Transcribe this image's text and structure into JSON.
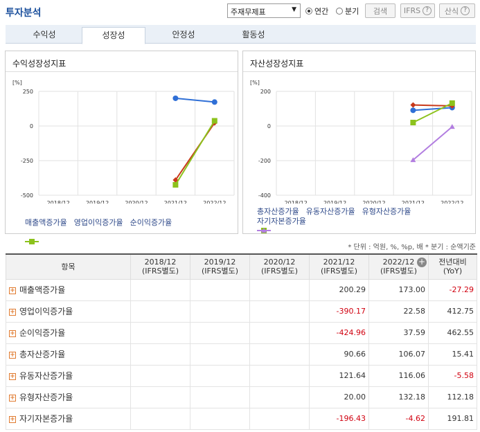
{
  "header": {
    "title": "투자분석",
    "select_value": "주재무제표",
    "radio_annual": "연간",
    "radio_quarter": "분기",
    "search_label": "검색",
    "ifrs_label": "IFRS",
    "formula_label": "산식"
  },
  "tabs": [
    "수익성",
    "성장성",
    "안정성",
    "활동성"
  ],
  "active_tab": 1,
  "panels": {
    "left_title": "수익성장성지표",
    "right_title": "자산성장성지표",
    "unit_label": "[%]"
  },
  "chart_data": [
    {
      "type": "line",
      "title": "수익성장성지표",
      "ylabel": "[%]",
      "categories": [
        "2018/12",
        "2019/12",
        "2020/12",
        "2021/12",
        "2022/12"
      ],
      "ylim": [
        -500,
        250
      ],
      "yticks": [
        250,
        0,
        -250,
        -500
      ],
      "legend_position": "bottom",
      "grid": true,
      "series": [
        {
          "name": "매출액증가율",
          "color": "#2f6fd6",
          "marker": "circle",
          "values": [
            null,
            null,
            null,
            200.29,
            173.0
          ]
        },
        {
          "name": "영업이익증가율",
          "color": "#c8391a",
          "marker": "diamond",
          "values": [
            null,
            null,
            null,
            -390.17,
            22.58
          ]
        },
        {
          "name": "순이익증가율",
          "color": "#8cc21d",
          "marker": "square",
          "values": [
            null,
            null,
            null,
            -424.96,
            37.59
          ]
        }
      ]
    },
    {
      "type": "line",
      "title": "자산성장성지표",
      "ylabel": "[%]",
      "categories": [
        "2018/12",
        "2019/12",
        "2020/12",
        "2021/12",
        "2022/12"
      ],
      "ylim": [
        -400,
        200
      ],
      "yticks": [
        200,
        0,
        -200,
        -400
      ],
      "legend_position": "bottom",
      "grid": true,
      "series": [
        {
          "name": "총자산증가율",
          "color": "#2f6fd6",
          "marker": "circle",
          "values": [
            null,
            null,
            null,
            90.66,
            106.07
          ]
        },
        {
          "name": "유동자산증가율",
          "color": "#c8391a",
          "marker": "diamond",
          "values": [
            null,
            null,
            null,
            121.64,
            116.06
          ]
        },
        {
          "name": "유형자산증가율",
          "color": "#8cc21d",
          "marker": "square",
          "values": [
            null,
            null,
            null,
            20.0,
            132.18
          ]
        },
        {
          "name": "자기자본증가율",
          "color": "#b27ee0",
          "marker": "triangle",
          "values": [
            null,
            null,
            null,
            -196.43,
            -4.62
          ]
        }
      ]
    }
  ],
  "unit_note": "* 단위 : 억원, %, %p, 배     * 분기 : 순액기준",
  "table": {
    "headers": [
      {
        "l1": "항목",
        "l2": ""
      },
      {
        "l1": "2018/12",
        "l2": "(IFRS별도)"
      },
      {
        "l1": "2019/12",
        "l2": "(IFRS별도)"
      },
      {
        "l1": "2020/12",
        "l2": "(IFRS별도)"
      },
      {
        "l1": "2021/12",
        "l2": "(IFRS별도)"
      },
      {
        "l1": "2022/12",
        "l2": "(IFRS별도)"
      },
      {
        "l1": "전년대비",
        "l2": "(YoY)"
      }
    ],
    "rows": [
      {
        "name": "매출액증가율",
        "cells": [
          "",
          "",
          "",
          "200.29",
          "173.00",
          "-27.29"
        ]
      },
      {
        "name": "영업이익증가율",
        "cells": [
          "",
          "",
          "",
          "-390.17",
          "22.58",
          "412.75"
        ]
      },
      {
        "name": "순이익증가율",
        "cells": [
          "",
          "",
          "",
          "-424.96",
          "37.59",
          "462.55"
        ]
      },
      {
        "name": "총자산증가율",
        "cells": [
          "",
          "",
          "",
          "90.66",
          "106.07",
          "15.41"
        ]
      },
      {
        "name": "유동자산증가율",
        "cells": [
          "",
          "",
          "",
          "121.64",
          "116.06",
          "-5.58"
        ]
      },
      {
        "name": "유형자산증가율",
        "cells": [
          "",
          "",
          "",
          "20.00",
          "132.18",
          "112.18"
        ]
      },
      {
        "name": "자기자본증가율",
        "cells": [
          "",
          "",
          "",
          "-196.43",
          "-4.62",
          "191.81"
        ]
      }
    ]
  }
}
